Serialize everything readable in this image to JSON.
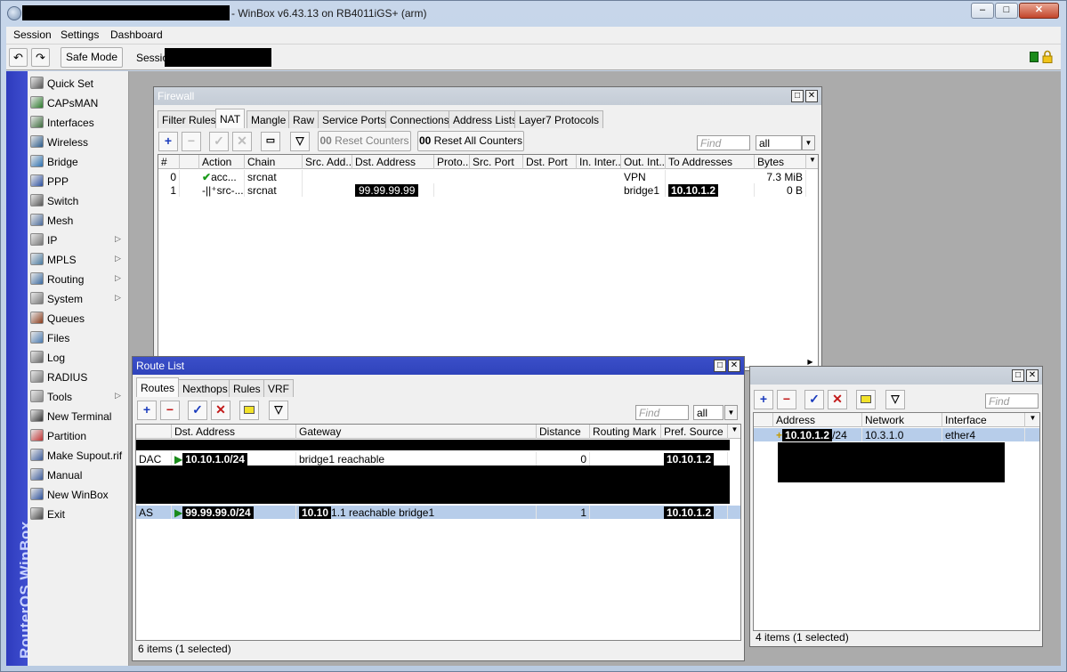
{
  "window": {
    "title": "- WinBox v6.43.13 on RB4011iGS+ (arm)",
    "min": "–",
    "max": "□",
    "close": "✕"
  },
  "menu": [
    "Session",
    "Settings",
    "Dashboard"
  ],
  "toolbar": {
    "undo": "↶",
    "redo": "↷",
    "safe_mode": "Safe Mode",
    "session_label": "Session"
  },
  "side_label": "RouterOS WinBox",
  "sidebar": [
    {
      "label": "Quick Set",
      "icon": "quick-set-icon",
      "sub": false
    },
    {
      "label": "CAPsMAN",
      "icon": "capsman-icon",
      "sub": false
    },
    {
      "label": "Interfaces",
      "icon": "interfaces-icon",
      "sub": false
    },
    {
      "label": "Wireless",
      "icon": "wireless-icon",
      "sub": false
    },
    {
      "label": "Bridge",
      "icon": "bridge-icon",
      "sub": false
    },
    {
      "label": "PPP",
      "icon": "ppp-icon",
      "sub": false
    },
    {
      "label": "Switch",
      "icon": "switch-icon",
      "sub": false
    },
    {
      "label": "Mesh",
      "icon": "mesh-icon",
      "sub": false
    },
    {
      "label": "IP",
      "icon": "ip-icon",
      "sub": true
    },
    {
      "label": "MPLS",
      "icon": "mpls-icon",
      "sub": true
    },
    {
      "label": "Routing",
      "icon": "routing-icon",
      "sub": true
    },
    {
      "label": "System",
      "icon": "system-icon",
      "sub": true
    },
    {
      "label": "Queues",
      "icon": "queues-icon",
      "sub": false
    },
    {
      "label": "Files",
      "icon": "files-icon",
      "sub": false
    },
    {
      "label": "Log",
      "icon": "log-icon",
      "sub": false
    },
    {
      "label": "RADIUS",
      "icon": "radius-icon",
      "sub": false
    },
    {
      "label": "Tools",
      "icon": "tools-icon",
      "sub": true
    },
    {
      "label": "New Terminal",
      "icon": "terminal-icon",
      "sub": false
    },
    {
      "label": "Partition",
      "icon": "partition-icon",
      "sub": false
    },
    {
      "label": "Make Supout.rif",
      "icon": "supout-icon",
      "sub": false
    },
    {
      "label": "Manual",
      "icon": "manual-icon",
      "sub": false
    },
    {
      "label": "New WinBox",
      "icon": "winbox-icon",
      "sub": false
    },
    {
      "label": "Exit",
      "icon": "exit-icon",
      "sub": false
    }
  ],
  "firewall": {
    "title": "Firewall",
    "tabs": [
      "Filter Rules",
      "NAT",
      "Mangle",
      "Raw",
      "Service Ports",
      "Connections",
      "Address Lists",
      "Layer7 Protocols"
    ],
    "selected_tab": "NAT",
    "reset_counters": "Reset Counters",
    "reset_all_counters": "Reset All Counters",
    "counter_prefix": "00",
    "find_placeholder": "Find",
    "filter_value": "all",
    "columns": [
      "#",
      "Action",
      "Chain",
      "Src. Add...",
      "Dst. Address",
      "Proto...",
      "Src. Port",
      "Dst. Port",
      "In. Inter...",
      "Out. Int...",
      "To Addresses",
      "Bytes"
    ],
    "rows": [
      {
        "num": "0",
        "action": "acc...",
        "chain": "srcnat",
        "dst": "",
        "out": "VPN",
        "to": "",
        "bytes": "7.3 MiB"
      },
      {
        "num": "1",
        "action": "src-...",
        "chain": "srcnat",
        "dst": "99.99.99.99",
        "out": "bridge1",
        "to": "10.10.1.2",
        "bytes": "0 B"
      }
    ]
  },
  "routes": {
    "title": "Route List",
    "tabs": [
      "Routes",
      "Nexthops",
      "Rules",
      "VRF"
    ],
    "selected_tab": "Routes",
    "find_placeholder": "Find",
    "filter_value": "all",
    "columns": [
      "Dst. Address",
      "Gateway",
      "Distance",
      "Routing Mark",
      "Pref. Source"
    ],
    "rows": [
      {
        "flags": "DAC",
        "dst": "10.10.1.0/24",
        "gateway": "bridge1 reachable",
        "distance": "0",
        "mark": "",
        "pref": "10.10.1.2"
      },
      {
        "flags": "AS",
        "dst": "99.99.99.0/24",
        "gateway_redacted": "10.10",
        "gateway": "1.1 reachable bridge1",
        "distance": "1",
        "mark": "",
        "pref": "10.10.1.2"
      }
    ],
    "status": "6 items (1 selected)"
  },
  "addresses": {
    "find_placeholder": "Find",
    "columns": [
      "Address",
      "Network",
      "Interface"
    ],
    "rows": [
      {
        "address": "10.10.1.2",
        "prefix": "/24",
        "network": "10.3.1.0",
        "interface": "ether4"
      }
    ],
    "status": "4 items (1 selected)"
  }
}
